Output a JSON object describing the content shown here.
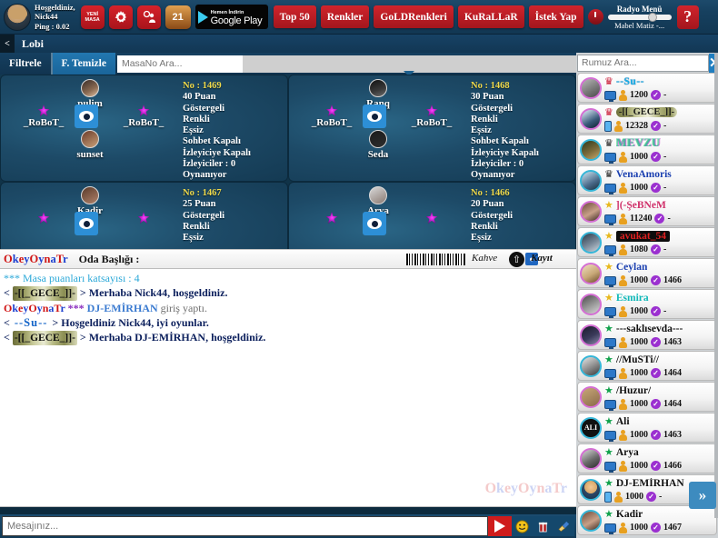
{
  "topbar": {
    "welcome_line1": "Hoşgeldiniz,",
    "welcome_line2": "Nick44",
    "ping": "Ping : 0.02",
    "new_table_label": "YENİ MASA",
    "settings_icon": "gear-icon",
    "friends_icon": "gear-people-icon",
    "online_count": "21",
    "google_play_small": "Hemen İndirin",
    "google_play_big": "Google Play",
    "buttons": [
      {
        "label": "Top 50"
      },
      {
        "label": "Renkler"
      },
      {
        "label": "GoLDRenkleri"
      },
      {
        "label": "KuRaLLaR"
      },
      {
        "label": "İstek Yap"
      }
    ],
    "radio_title": "Radyo Menü",
    "radio_now_playing": "Mabel Matiz -...",
    "help_label": "?"
  },
  "lobibar": {
    "back": "<",
    "title": "Lobi"
  },
  "filterbar": {
    "filter_label": "Filtrele",
    "clear_label": "F. Temizle",
    "search_placeholder": "MasaNo Ara..."
  },
  "tables": [
    {
      "top_player": "pulim",
      "left_player": "_RoBoT_",
      "right_player": "_RoBoT_",
      "bottom_player": "sunset",
      "info": [
        "No : 1469",
        "40 Puan",
        "Göstergeli",
        "Renkli",
        "Eşsiz",
        "Sohbet Kapalı",
        "İzleyiciye Kapalı",
        "İzleyiciler : 0",
        "Oynanıyor"
      ]
    },
    {
      "top_player": "Ranq",
      "left_player": "_RoBoT_",
      "right_player": "_RoBoT_",
      "bottom_player": "Seda",
      "info": [
        "No : 1468",
        "30 Puan",
        "Göstergeli",
        "Renkli",
        "Eşsiz",
        "Sohbet Kapalı",
        "İzleyiciye Kapalı",
        "İzleyiciler : 0",
        "Oynanıyor"
      ]
    },
    {
      "top_player": "Kadir",
      "left_player": "",
      "right_player": "",
      "bottom_player": "",
      "info": [
        "No : 1467",
        "25 Puan",
        "Göstergeli",
        "Renkli",
        "Eşsiz"
      ]
    },
    {
      "top_player": "Arya",
      "left_player": "",
      "right_player": "",
      "bottom_player": "",
      "info": [
        "No : 1466",
        "20 Puan",
        "Göstergeli",
        "Renkli",
        "Eşsiz"
      ]
    }
  ],
  "chat_header": {
    "brand": "OkeyOynaTr",
    "room_title": "Oda Başlığı :",
    "kahve": "Kahve",
    "kayit": "Kayıt"
  },
  "chat_messages": [
    {
      "type": "system",
      "text": "*** Masa puanları katsayısı : 4"
    },
    {
      "type": "nick_gece",
      "prefix": "<",
      "nick": "-[[_GECE_]]-",
      "suffix": ">",
      "text": "Merhaba Nick44, hoşgeldiniz."
    },
    {
      "type": "brand_notice",
      "brand": "OkeyOynaTr",
      "stars": "***",
      "nick": "DJ-EMİRHAN",
      "text": "giriş yaptı."
    },
    {
      "type": "nick_su",
      "prefix": "<",
      "nick": "--Su--",
      "suffix": ">",
      "text": "Hoşgeldiniz Nick44, iyi oyunlar."
    },
    {
      "type": "nick_gece",
      "prefix": "<",
      "nick": "-[[_GECE_]]-",
      "suffix": ">",
      "text": "Merhaba DJ-EMİRHAN, hoşgeldiniz."
    }
  ],
  "chat_watermark": "OkeyOynaTr",
  "input_bar": {
    "placeholder": "Mesajınız...",
    "send_icon": "send-arrow-icon",
    "emoji_icon": "smiley-icon",
    "gift_icon": "gift-icon",
    "broom_icon": "broom-icon"
  },
  "sidebar": {
    "search_placeholder": "Rumuz Ara...",
    "close_label": "✕",
    "next_label": "»",
    "users": [
      {
        "rank_icon": "crown-red",
        "name": "--Su--",
        "name_style": "su",
        "device": "monitor",
        "points": "1200",
        "table": "-",
        "avatar": "a1",
        "ring": "pink"
      },
      {
        "rank_icon": "crown-red",
        "name": "-[[_GECE_]]-",
        "name_style": "gece",
        "device": "phone",
        "points": "12328",
        "table": "-",
        "avatar": "a2",
        "ring": "pink"
      },
      {
        "rank_icon": "crown-black",
        "name": "MEVZU",
        "name_style": "mevzu",
        "device": "monitor",
        "points": "1000",
        "table": "-",
        "avatar": "a3",
        "ring": "cyan"
      },
      {
        "rank_icon": "crown-black",
        "name": "VenaAmoris",
        "name_style": "vena",
        "device": "monitor",
        "points": "1000",
        "table": "-",
        "avatar": "a4",
        "ring": "cyan"
      },
      {
        "rank_icon": "star-gold",
        "name": "](-ŞeBNeM",
        "name_style": "sebnem",
        "device": "monitor",
        "points": "11240",
        "table": "-",
        "avatar": "a5",
        "ring": "pink"
      },
      {
        "rank_icon": "star-gold",
        "name": "avukat_54",
        "name_style": "avukat",
        "device": "monitor",
        "points": "1080",
        "table": "-",
        "avatar": "a6",
        "ring": "cyan"
      },
      {
        "rank_icon": "star-gold",
        "name": "Ceylan",
        "name_style": "ceylan",
        "device": "monitor",
        "points": "1000",
        "table": "1466",
        "avatar": "a7",
        "ring": "pink"
      },
      {
        "rank_icon": "star-gold",
        "name": "Esmira",
        "name_style": "esmira",
        "device": "monitor",
        "points": "1000",
        "table": "-",
        "avatar": "a8",
        "ring": "pink"
      },
      {
        "rank_icon": "star-green",
        "name": "---saklısevda---",
        "name_style": "plain",
        "device": "monitor",
        "points": "1000",
        "table": "1463",
        "avatar": "a9",
        "ring": "pink"
      },
      {
        "rank_icon": "star-green",
        "name": "//MuSTi//",
        "name_style": "plain",
        "device": "monitor",
        "points": "1000",
        "table": "1464",
        "avatar": "a10",
        "ring": "cyan"
      },
      {
        "rank_icon": "star-green",
        "name": "/Huzur/",
        "name_style": "plain",
        "device": "monitor",
        "points": "1000",
        "table": "1464",
        "avatar": "a14",
        "ring": "pink"
      },
      {
        "rank_icon": "star-green",
        "name": "Ali",
        "name_style": "plain",
        "device": "monitor",
        "points": "1000",
        "table": "1463",
        "avatar": "a11",
        "ring": "cyan",
        "avatar_text": "ALI"
      },
      {
        "rank_icon": "star-green",
        "name": "Arya",
        "name_style": "plain",
        "device": "monitor",
        "points": "1000",
        "table": "1466",
        "avatar": "a12",
        "ring": "pink"
      },
      {
        "rank_icon": "star-green",
        "name": "DJ-EMİRHAN",
        "name_style": "plain",
        "device": "phone",
        "points": "1000",
        "table": "-",
        "avatar": "a13",
        "ring": "cyan"
      },
      {
        "rank_icon": "star-green",
        "name": "Kadir",
        "name_style": "plain",
        "device": "monitor",
        "points": "1000",
        "table": "1467",
        "avatar": "a5",
        "ring": "cyan"
      }
    ]
  }
}
